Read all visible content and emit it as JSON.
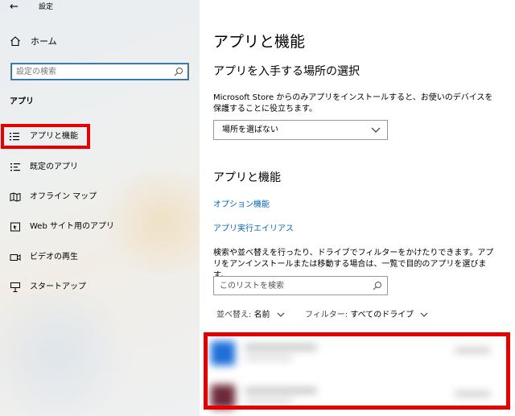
{
  "window": {
    "title": "設定",
    "back_icon": "back-arrow-icon"
  },
  "sidebar": {
    "home_label": "ホーム",
    "search_placeholder": "設定の検索",
    "section_header": "アプリ",
    "items": [
      {
        "label": "アプリと機能",
        "icon": "apps-list-icon",
        "selected": true
      },
      {
        "label": "既定のアプリ",
        "icon": "default-apps-icon",
        "selected": false
      },
      {
        "label": "オフライン マップ",
        "icon": "offline-map-icon",
        "selected": false
      },
      {
        "label": "Web サイト用のアプリ",
        "icon": "website-apps-icon",
        "selected": false
      },
      {
        "label": "ビデオの再生",
        "icon": "video-playback-icon",
        "selected": false
      },
      {
        "label": "スタートアップ",
        "icon": "startup-icon",
        "selected": false
      }
    ]
  },
  "main": {
    "page_title": "アプリと機能",
    "install_section": {
      "heading": "アプリを入手する場所の選択",
      "description": "Microsoft Store からのみアプリをインストールすると、お使いのデバイスを保護することに役立ちます。",
      "dropdown_value": "場所を選ばない"
    },
    "apps_section": {
      "heading": "アプリと機能",
      "links": [
        "オプション機能",
        "アプリ実行エイリアス"
      ],
      "description": "検索や並べ替えを行ったり、ドライブでフィルターをかけたりできます。アプリをアンインストールまたは移動する場合は、一覧で目的のアプリを選びます。",
      "search_placeholder": "このリストを検索",
      "sort_label": "並べ替え:",
      "sort_value": "名前",
      "filter_label": "フィルター:",
      "filter_value": "すべてのドライブ"
    }
  },
  "colors": {
    "accent": "#0078d7",
    "link": "#0067b8",
    "highlight": "#e60000",
    "app_icon_1": "#1e6fd9",
    "app_icon_2": "#6d2a3a"
  }
}
